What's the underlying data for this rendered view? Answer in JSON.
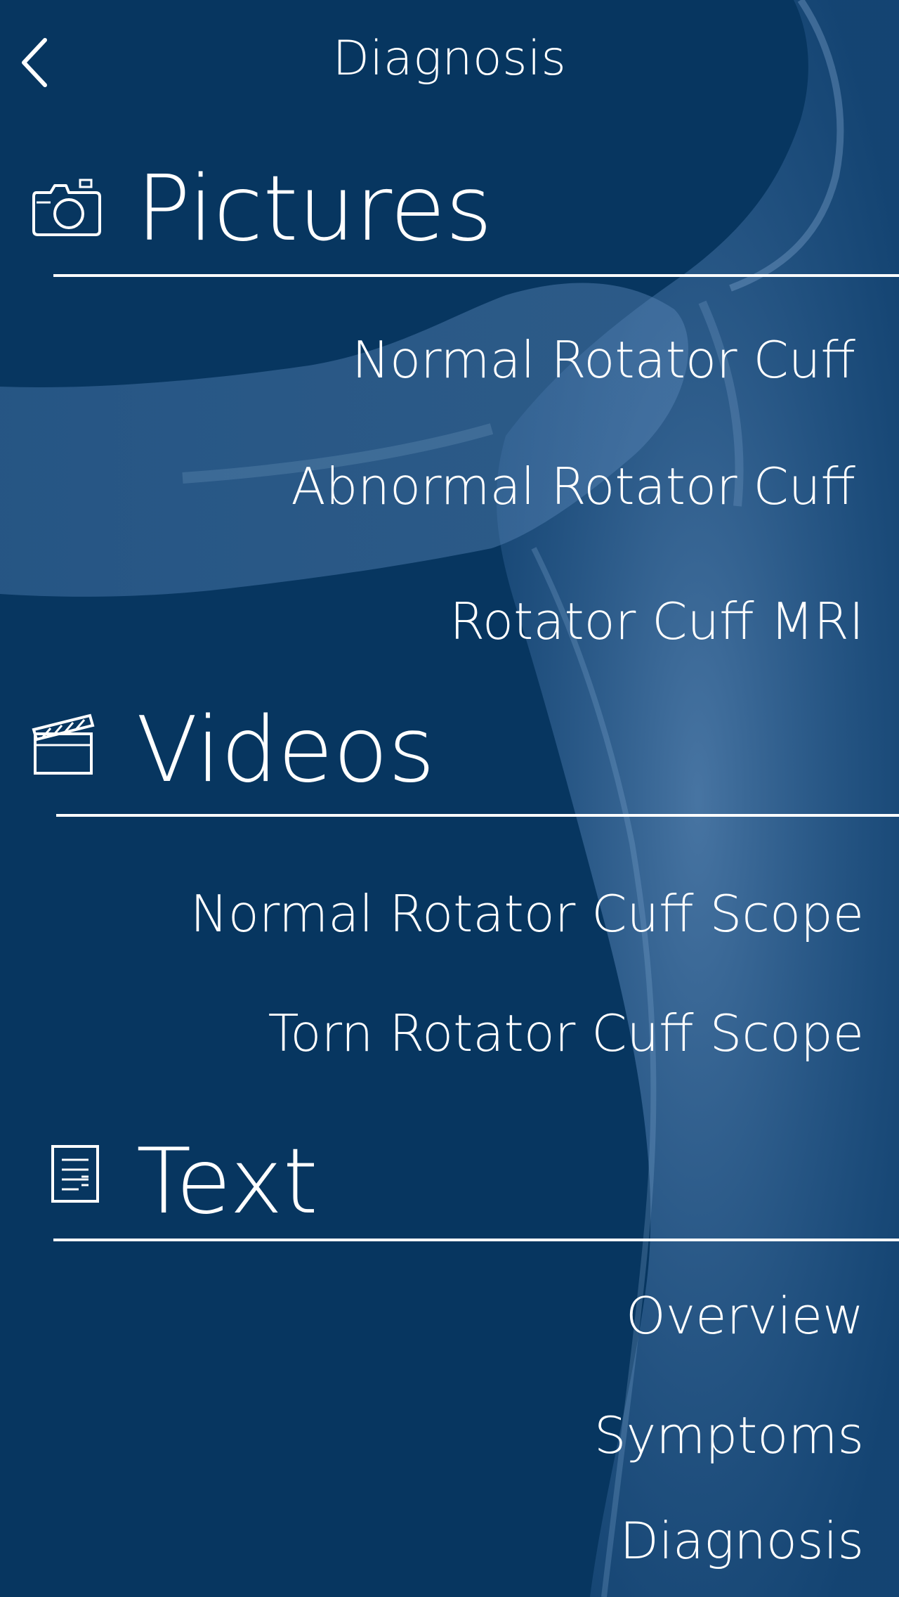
{
  "header": {
    "title": "Diagnosis"
  },
  "sections": [
    {
      "title": "Pictures",
      "icon": "camera-icon",
      "items": [
        {
          "label": "Normal Rotator Cuff"
        },
        {
          "label": "Abnormal Rotator Cuff"
        },
        {
          "label": "Rotator Cuff MRI"
        }
      ]
    },
    {
      "title": "Videos",
      "icon": "clapperboard-icon",
      "items": [
        {
          "label": "Normal Rotator Cuff Scope"
        },
        {
          "label": "Torn Rotator Cuff Scope"
        }
      ]
    },
    {
      "title": "Text",
      "icon": "document-icon",
      "items": [
        {
          "label": "Overview"
        },
        {
          "label": "Symptoms"
        },
        {
          "label": "Diagnosis"
        }
      ]
    }
  ],
  "colors": {
    "background": "#073660",
    "foreground": "#ffffff",
    "anatomy_overlay": "#4f7fb2"
  }
}
